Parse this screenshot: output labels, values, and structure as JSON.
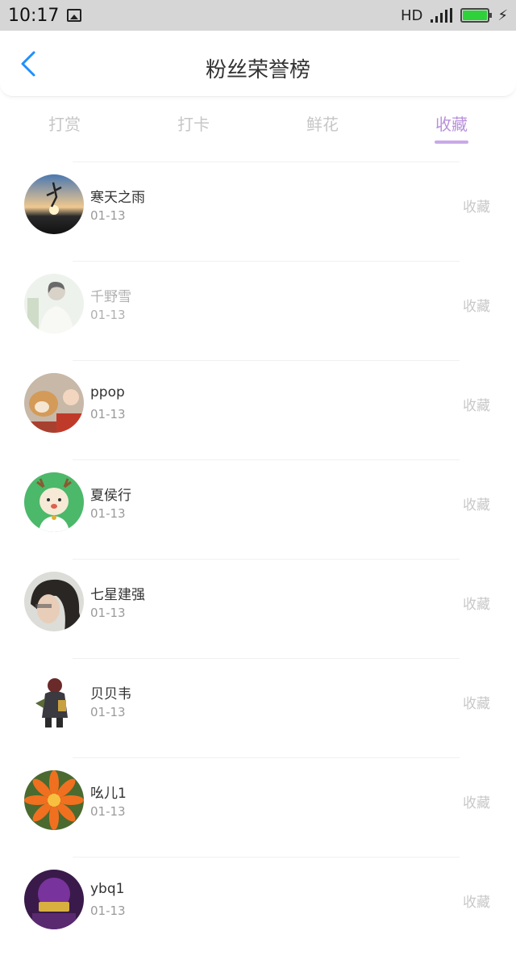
{
  "status": {
    "time": "10:17",
    "network": "HD"
  },
  "header": {
    "title": "粉丝荣誉榜"
  },
  "tabs": [
    {
      "label": "打赏",
      "active": false
    },
    {
      "label": "打卡",
      "active": false
    },
    {
      "label": "鲜花",
      "active": false
    },
    {
      "label": "收藏",
      "active": true
    }
  ],
  "list": [
    {
      "name": "寒天之雨",
      "date": "01-13",
      "action": "收藏"
    },
    {
      "name": "千野雪",
      "date": "01-13",
      "action": "收藏"
    },
    {
      "name": "ppop",
      "date": "01-13",
      "action": "收藏"
    },
    {
      "name": "夏侯行",
      "date": "01-13",
      "action": "收藏"
    },
    {
      "name": "七星建强",
      "date": "01-13",
      "action": "收藏"
    },
    {
      "name": "贝贝韦",
      "date": "01-13",
      "action": "收藏"
    },
    {
      "name": "吆儿1",
      "date": "01-13",
      "action": "收藏"
    },
    {
      "name": "ybq1",
      "date": "01-13",
      "action": "收藏"
    }
  ],
  "colors": {
    "accent": "#b890db",
    "back": "#1e90ff"
  }
}
